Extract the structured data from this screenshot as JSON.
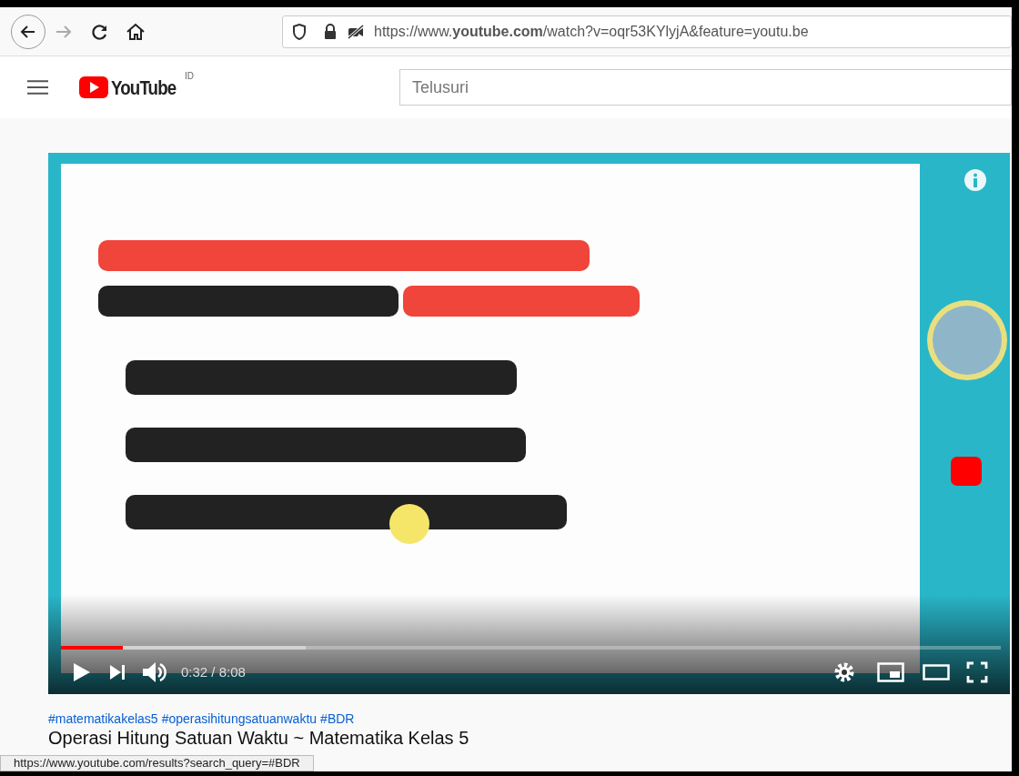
{
  "browser": {
    "url": "https://www.**youtube.com**/watch?v=oqr53KYlyjA&feature=youtu.be"
  },
  "header": {
    "logo": "YouTube",
    "region": "ID",
    "search": {
      "placeholder": "Telusuri"
    }
  },
  "player": {
    "progress": {
      "level": 0.066
    },
    "buffered": {
      "level": 0.26
    },
    "time": "0:32 / 8:08"
  },
  "hashtags": [
    "#matematikakelas5",
    "#operasihitungsatuanwaktu",
    "#BDR"
  ],
  "title": "Operasi Hitung Satuan Waktu ~ Matematika Kelas 5",
  "status_bar": "https://www.youtube.com/results?search_query=#BDR"
}
